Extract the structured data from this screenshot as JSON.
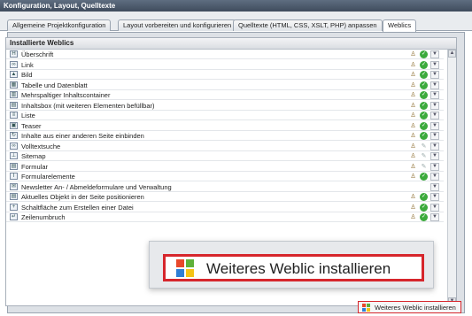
{
  "window": {
    "title": "Konfiguration, Layout, Quelltexte"
  },
  "tabs": [
    {
      "label": "Allgemeine Projektkonfiguration"
    },
    {
      "label": "Layout vorbereiten und konfigurieren"
    },
    {
      "label": "Quelltexte (HTML, CSS, XSLT, PHP) anpassen"
    },
    {
      "label": "Weblics"
    }
  ],
  "section": {
    "title": "Installierte Weblics"
  },
  "items": [
    {
      "label": "Überschrift",
      "icon": "heading-icon",
      "glyph": "H"
    },
    {
      "label": "Link",
      "icon": "link-icon",
      "glyph": "∞"
    },
    {
      "label": "Bild",
      "icon": "image-icon",
      "glyph": "▲"
    },
    {
      "label": "Tabelle und Datenblatt",
      "icon": "table-icon",
      "glyph": "▦"
    },
    {
      "label": "Mehrspaltiger Inhaltscontainer",
      "icon": "columns-icon",
      "glyph": "▥"
    },
    {
      "label": "Inhaltsbox (mit weiteren Elementen befüllbar)",
      "icon": "box-icon",
      "glyph": "▤"
    },
    {
      "label": "Liste",
      "icon": "list-icon",
      "glyph": "≡"
    },
    {
      "label": "Teaser",
      "icon": "teaser-icon",
      "glyph": "▣"
    },
    {
      "label": "Inhalte aus einer anderen Seite einbinden",
      "icon": "include-page-icon",
      "glyph": "↻"
    },
    {
      "label": "Volltextsuche",
      "icon": "binoculars-icon",
      "glyph": "∞"
    },
    {
      "label": "Sitemap",
      "icon": "sitemap-icon",
      "glyph": "⊥"
    },
    {
      "label": "Formular",
      "icon": "form-icon",
      "glyph": "▤"
    },
    {
      "label": "Formularelemente",
      "icon": "form-element-icon",
      "glyph": "I"
    },
    {
      "label": "Newsletter An- / Abmeldeformulare und Verwaltung",
      "icon": "newsletter-icon",
      "glyph": "✉"
    },
    {
      "label": "Aktuelles Objekt in der Seite positionieren",
      "icon": "position-icon",
      "glyph": "▤"
    },
    {
      "label": "Schaltfläche zum Erstellen einer Datei",
      "icon": "file-button-icon",
      "glyph": "+"
    },
    {
      "label": "Zeilenumbruch",
      "icon": "linebreak-icon",
      "glyph": "↵"
    }
  ],
  "popup": {
    "label": "Weiteres Weblic installieren"
  },
  "footer": {
    "button_label": "Weiteres Weblic installieren"
  },
  "colors": {
    "accent_red": "#d6262c",
    "check_green": "#3caa3c",
    "title_bar": "#4a5869"
  }
}
